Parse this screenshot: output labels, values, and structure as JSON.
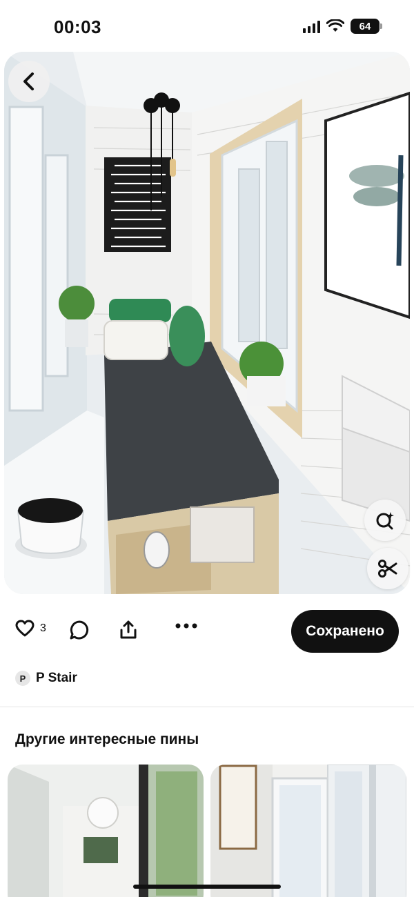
{
  "status_bar": {
    "time": "00:03",
    "battery_level": "64",
    "icons": [
      "signal-icon",
      "wifi-icon",
      "battery-icon"
    ]
  },
  "pin": {
    "image_icon": "balcony-photo",
    "back_icon": "chevron-left-icon",
    "tools": [
      "visual-search-icon",
      "scissors-icon"
    ]
  },
  "actions": {
    "like_count": "3",
    "icons": [
      "heart-icon",
      "comment-icon",
      "share-icon",
      "more-icon"
    ],
    "save_label": "Сохранено"
  },
  "author": {
    "initial": "P",
    "name": "P Stair"
  },
  "related": {
    "title": "Другие интересные пины"
  },
  "colors": {
    "save_button_bg": "#111111",
    "save_button_text": "#ffffff",
    "divider": "#e4e4e4"
  }
}
